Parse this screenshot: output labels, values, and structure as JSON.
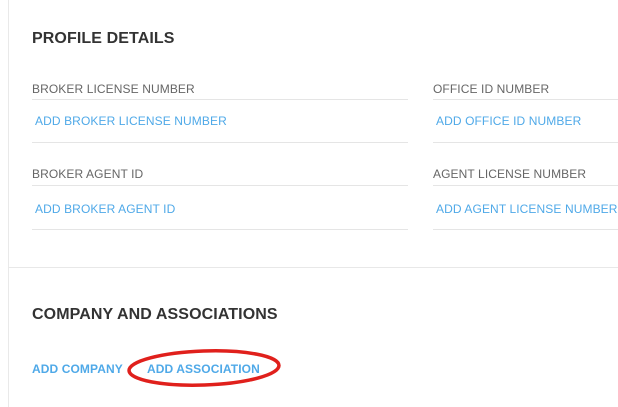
{
  "profile": {
    "title": "PROFILE DETAILS",
    "fields": {
      "broker_license": {
        "label": "BROKER LICENSE NUMBER",
        "value": "ADD BROKER LICENSE NUMBER"
      },
      "office_id": {
        "label": "OFFICE ID NUMBER",
        "value": "ADD OFFICE ID NUMBER"
      },
      "broker_agent": {
        "label": "BROKER AGENT ID",
        "value": "ADD BROKER AGENT ID"
      },
      "agent_license": {
        "label": "AGENT LICENSE NUMBER",
        "value": "ADD AGENT LICENSE NUMBER"
      }
    }
  },
  "company": {
    "title": "COMPANY AND ASSOCIATIONS",
    "add_company": "ADD COMPANY",
    "add_association": "ADD ASSOCIATION"
  },
  "colors": {
    "link": "#4fa9e8",
    "heading": "#333333",
    "label": "#666666",
    "annotation": "#e0201c"
  }
}
